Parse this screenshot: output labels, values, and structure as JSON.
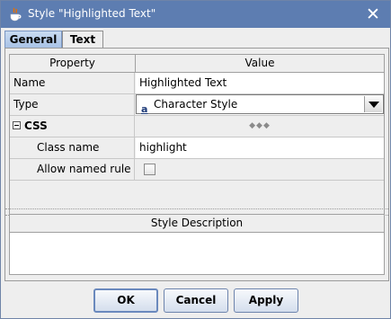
{
  "window": {
    "title": "Style \"Highlighted Text\""
  },
  "tabs": [
    {
      "label": "General",
      "selected": true
    },
    {
      "label": "Text",
      "selected": false
    }
  ],
  "property_table": {
    "headers": {
      "property": "Property",
      "value": "Value"
    },
    "rows": {
      "name": {
        "label": "Name",
        "value": "Highlighted Text"
      },
      "type": {
        "label": "Type",
        "value": "Character Style",
        "icon": "a"
      },
      "css": {
        "label": "CSS",
        "value": "◆◆◆",
        "expanded": true
      },
      "class_name": {
        "label": "Class name",
        "value": "highlight"
      },
      "allow_named_rule": {
        "label": "Allow named rule",
        "checked": false
      }
    }
  },
  "description": {
    "header": "Style Description",
    "value": ""
  },
  "buttons": {
    "ok": "OK",
    "cancel": "Cancel",
    "apply": "Apply"
  },
  "colors": {
    "titlebar": "#5d7db1",
    "selected_tab": "#a8c2e6"
  }
}
